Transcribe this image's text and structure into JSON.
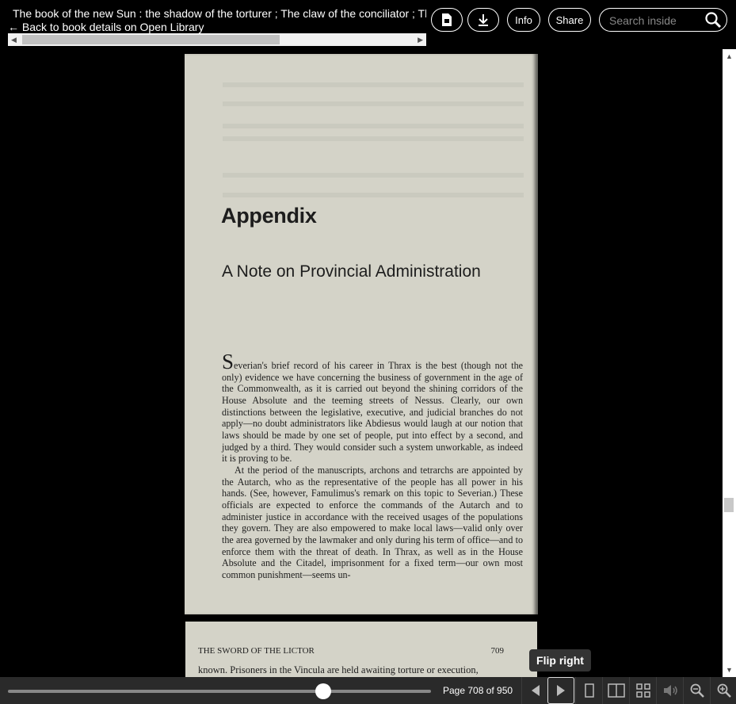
{
  "header": {
    "title": "The book of the new Sun : the shadow of the torturer ; The claw of the conciliator ; The sword of the lictor ; The citadel of the autarch",
    "back_link": "← Back to book details on Open Library",
    "buttons": {
      "info": "Info",
      "share": "Share"
    },
    "search": {
      "placeholder": "Search inside",
      "value": ""
    }
  },
  "page_left": {
    "heading": "Appendix",
    "subheading": "A Note on Provincial Administration",
    "dropcap": "S",
    "para1_rest": "everian's brief record of his career in Thrax is the best (though not the only) evidence we have concerning the business of government in the age of the Commonwealth, as it is carried out beyond the shining corridors of the House Absolute and the teeming streets of Nessus. Clearly, our own distinctions between the legislative, executive, and judicial branches do not apply—no doubt administrators like Abdiesus would laugh at our notion that laws should be made by one set of people, put into effect by a second, and judged by a third. They would consider such a system unworkable, as indeed it is proving to be.",
    "para2": "At the period of the manuscripts, archons and tetrarchs are appointed by the Autarch, who as the representative of the people has all power in his hands. (See, however, Famulimus's remark on this topic to Severian.) These officials are expected to enforce the commands of the Autarch and to administer justice in accordance with the received usages of the populations they govern. They are also empowered to make local laws—valid only over the area governed by the lawmaker and only during his term of office—and to enforce them with the threat of death. In Thrax, as well as in the House Absolute and the Citadel, imprisonment for a fixed term—our own most common punishment—seems un-"
  },
  "page_right": {
    "running_head": "THE SWORD OF THE LICTOR",
    "page_number": "709",
    "first_line": "known. Prisoners in the Vincula are held awaiting torture or execution,"
  },
  "footer": {
    "page_label": "Page 708 of 950",
    "progress_fraction": 0.745,
    "tooltip": "Flip right"
  },
  "icons": {
    "pdf": "pdf-file-icon",
    "download": "download-icon",
    "search": "search-icon",
    "flip_left": "flip-left-icon",
    "flip_right": "flip-right-icon",
    "one_page": "one-page-view-icon",
    "two_page": "two-page-view-icon",
    "thumbnail": "thumbnail-view-icon",
    "read_aloud": "read-aloud-icon",
    "zoom_out": "zoom-out-icon",
    "zoom_in": "zoom-in-icon"
  },
  "colors": {
    "background": "#000000",
    "page_paper": "#d4d3c8",
    "footer_bar": "#2a2a2a"
  }
}
